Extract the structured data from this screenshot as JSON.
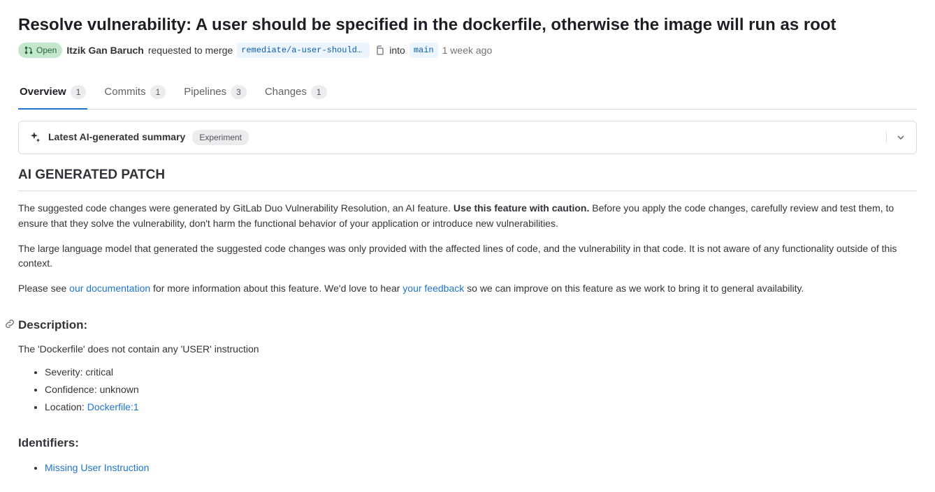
{
  "title": "Resolve vulnerability: A user should be specified in the dockerfile, otherwise the image will run as root",
  "status": {
    "label": "Open"
  },
  "author": "Itzik Gan Baruch",
  "request_text": "requested to merge",
  "source_branch": "remediate/a-user-should-be…",
  "into_text": "into",
  "target_branch": "main",
  "time_ago": "1 week ago",
  "tabs": {
    "overview": {
      "label": "Overview",
      "count": "1"
    },
    "commits": {
      "label": "Commits",
      "count": "1"
    },
    "pipelines": {
      "label": "Pipelines",
      "count": "3"
    },
    "changes": {
      "label": "Changes",
      "count": "1"
    }
  },
  "summary": {
    "title": "Latest AI-generated summary",
    "badge": "Experiment"
  },
  "patch": {
    "heading": "AI GENERATED PATCH",
    "p1_a": "The suggested code changes were generated by GitLab Duo Vulnerability Resolution, an AI feature. ",
    "p1_bold": "Use this feature with caution.",
    "p1_b": " Before you apply the code changes, carefully review and test them, to ensure that they solve the vulnerability, don't harm the functional behavior of your application or introduce new vulnerabilities.",
    "p2": "The large language model that generated the suggested code changes was only provided with the affected lines of code, and the vulnerability in that code. It is not aware of any functionality outside of this context.",
    "p3_a": "Please see ",
    "p3_link1": "our documentation",
    "p3_b": " for more information about this feature. We'd love to hear ",
    "p3_link2": "your feedback",
    "p3_c": " so we can improve on this feature as we work to bring it to general availability."
  },
  "description": {
    "heading": "Description:",
    "text": "The 'Dockerfile' does not contain any 'USER' instruction",
    "severity_label": "Severity: ",
    "severity_value": "critical",
    "confidence_label": "Confidence: ",
    "confidence_value": "unknown",
    "location_label": "Location: ",
    "location_link": "Dockerfile:1"
  },
  "identifiers": {
    "heading": "Identifiers:",
    "item1": "Missing User Instruction"
  }
}
